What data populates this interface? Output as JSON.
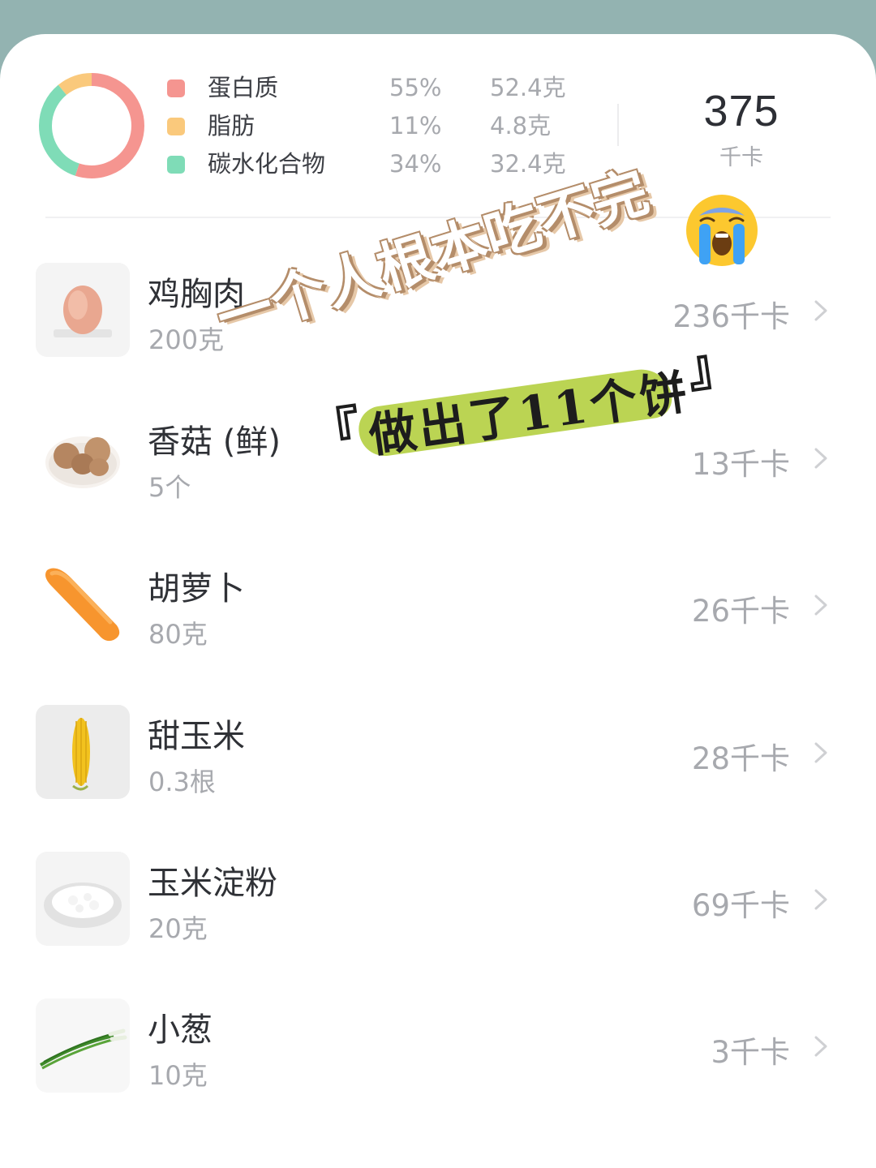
{
  "summary": {
    "macros": [
      {
        "name": "蛋白质",
        "percent": "55%",
        "amount": "52.4克",
        "color": "#f59590",
        "share": 0.55
      },
      {
        "name": "脂肪",
        "percent": "11%",
        "amount": "4.8克",
        "color": "#fac97c",
        "share": 0.11
      },
      {
        "name": "碳水化合物",
        "percent": "34%",
        "amount": "32.4克",
        "color": "#7fdcb7",
        "share": 0.34
      }
    ],
    "total_value": "375",
    "total_unit": "千卡"
  },
  "foods": [
    {
      "name": "鸡胸肉",
      "qty": "200克",
      "kcal": "236千卡",
      "icon": "chicken-breast-icon"
    },
    {
      "name": "香菇 (鲜)",
      "qty": "5个",
      "kcal": "13千卡",
      "icon": "shiitake-mushroom-icon"
    },
    {
      "name": "胡萝卜",
      "qty": "80克",
      "kcal": "26千卡",
      "icon": "carrot-icon"
    },
    {
      "name": "甜玉米",
      "qty": "0.3根",
      "kcal": "28千卡",
      "icon": "corn-icon"
    },
    {
      "name": "玉米淀粉",
      "qty": "20克",
      "kcal": "69千卡",
      "icon": "cornstarch-icon"
    },
    {
      "name": "小葱",
      "qty": "10克",
      "kcal": "3千卡",
      "icon": "scallion-icon"
    }
  ],
  "annotation": {
    "headline": "一个人根本吃不完",
    "emoji": "😭",
    "bracket_open": "『",
    "subtext": "做出了11个饼",
    "bracket_close": "』"
  }
}
